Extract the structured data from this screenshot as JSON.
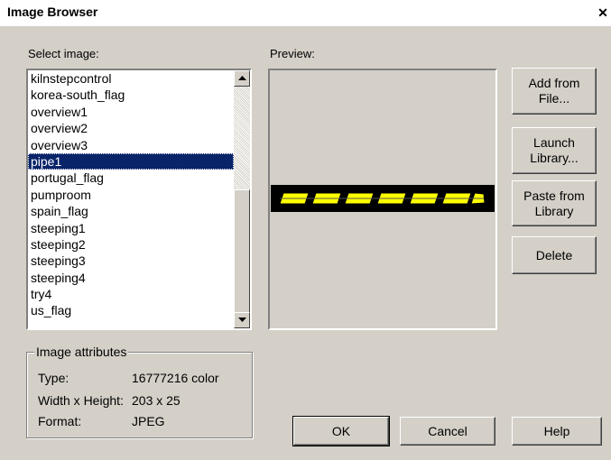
{
  "window": {
    "title": "Image Browser",
    "close_glyph": "✕"
  },
  "labels": {
    "select_image": "Select image:",
    "preview": "Preview:"
  },
  "images": {
    "selected": "pipe1",
    "items": [
      "kilnstepcontrol",
      "korea-south_flag",
      "overview1",
      "overview2",
      "overview3",
      "pipe1",
      "portugal_flag",
      "pumproom",
      "spain_flag",
      "steeping1",
      "steeping2",
      "steeping3",
      "steeping4",
      "try4",
      "us_flag"
    ]
  },
  "attributes": {
    "legend": "Image attributes",
    "type_label": "Type:",
    "type_value": "16777216 color",
    "size_label": "Width x Height:",
    "size_value": "203 x 25",
    "format_label": "Format:",
    "format_value": "JPEG"
  },
  "buttons": {
    "add_from_file": "Add from\nFile...",
    "launch_library": "Launch\nLibrary...",
    "paste_from_library": "Paste from\nLibrary",
    "delete": "Delete",
    "ok": "OK",
    "cancel": "Cancel",
    "help": "Help"
  },
  "icons": {
    "close": "close-icon",
    "scroll_up": "arrow-up-icon",
    "scroll_down": "arrow-down-icon"
  },
  "colors": {
    "selection": "#0a246a",
    "pipe_fill": "#ffff00",
    "preview_strip": "#000000"
  }
}
